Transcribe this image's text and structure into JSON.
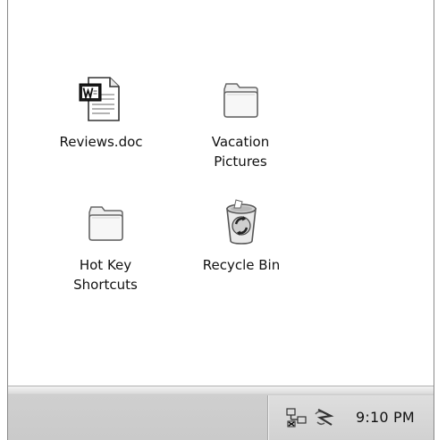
{
  "desktop": {
    "icons": [
      {
        "label": "Reviews.doc",
        "icon": "word-document-icon"
      },
      {
        "label": "Vacation\nPictures",
        "icon": "folder-icon"
      },
      {
        "label": "Hot Key\nShortcuts",
        "icon": "folder-icon"
      },
      {
        "label": "Recycle Bin",
        "icon": "recycle-bin-icon"
      }
    ]
  },
  "taskbar": {
    "tray": {
      "icons": [
        "network-icon",
        "bluetooth-icon"
      ],
      "clock": "9:10 PM"
    }
  },
  "colors": {
    "background": "#ffffff",
    "taskbar": "#cfcfcf",
    "text": "#111111"
  }
}
